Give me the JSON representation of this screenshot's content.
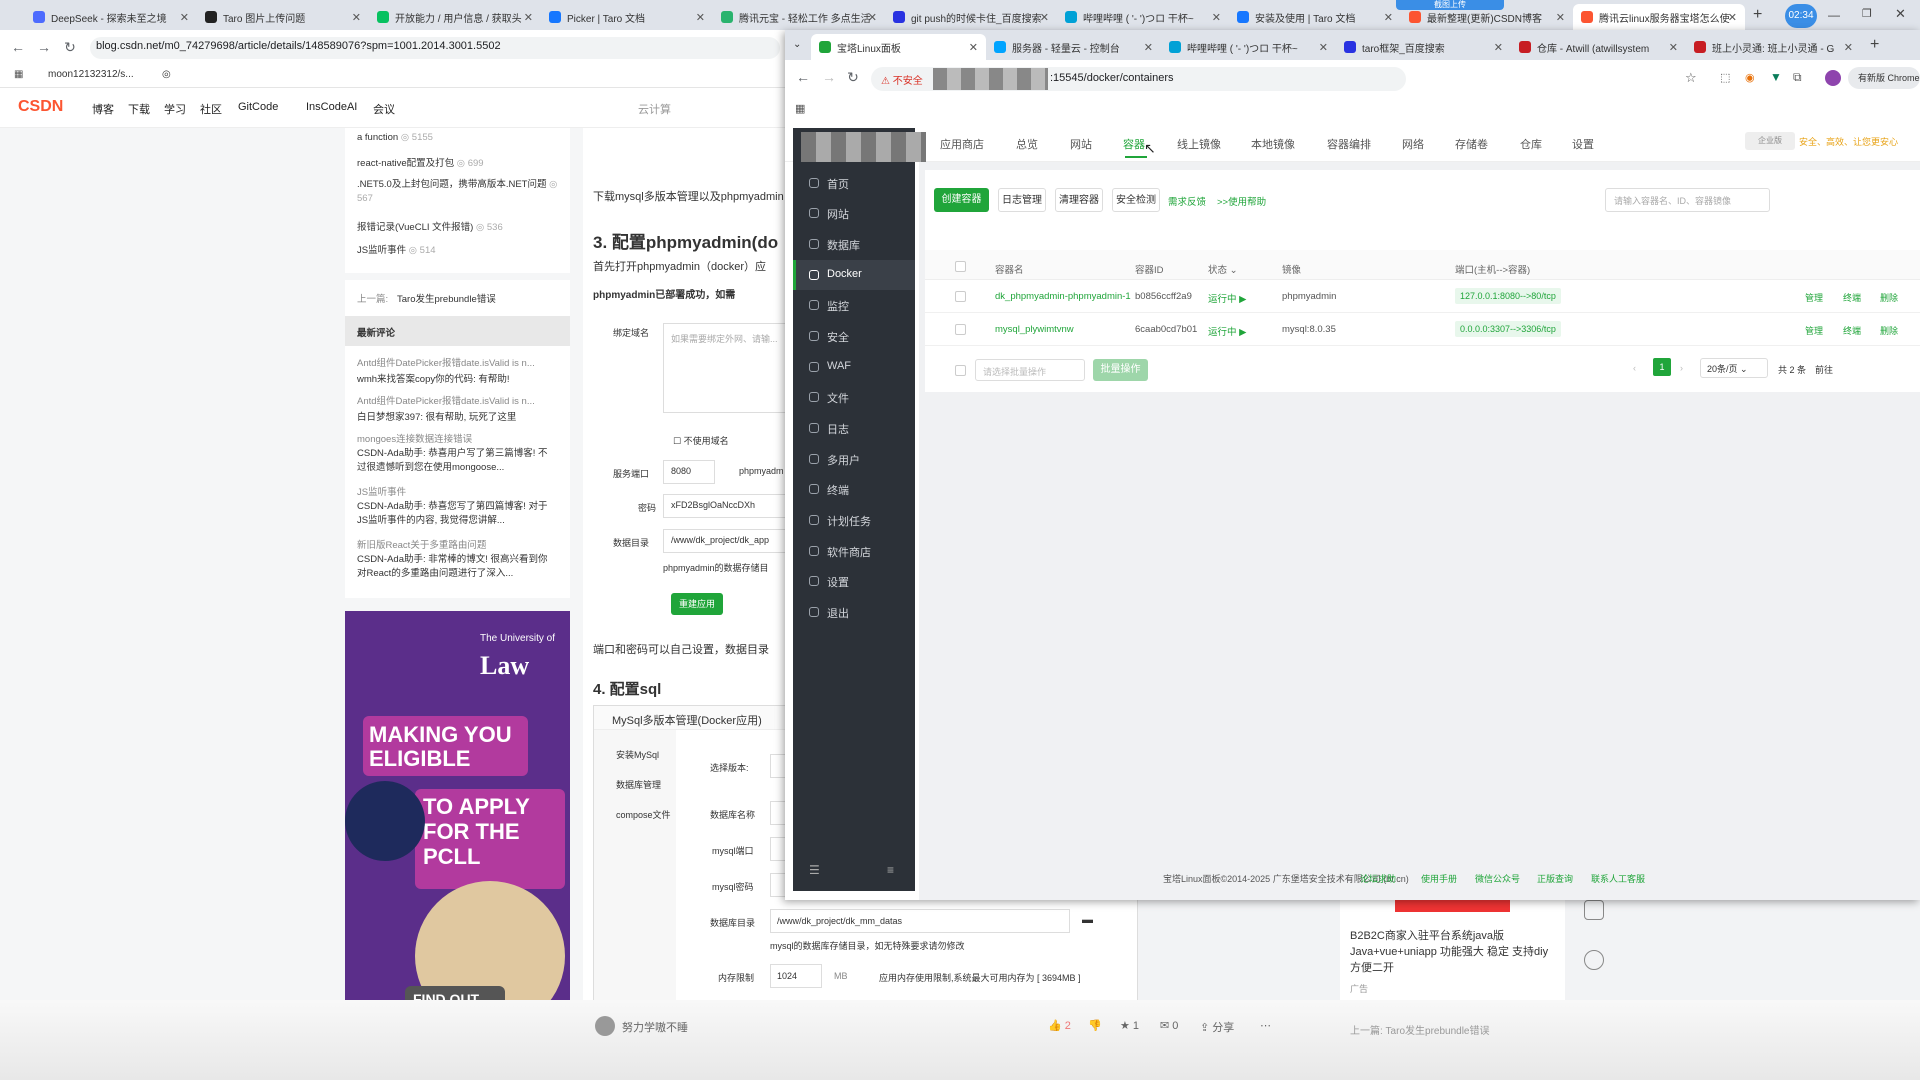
{
  "back_browser": {
    "tabs": [
      "DeepSeek - 探索未至之境",
      "Taro 图片上传问题",
      "开放能力 / 用户信息 / 获取头",
      "Picker | Taro 文档",
      "腾讯元宝 - 轻松工作 多点生活",
      "git push的时候卡住_百度搜索",
      "哔哩哔哩 ( '- ')つロ 干杯~",
      "安装及使用 | Taro 文档",
      "最新整理(更新)CSDN博客",
      "腾讯云linux服务器宝塔怎么使"
    ],
    "url": "blog.csdn.net/m0_74279698/article/details/148589076?spm=1001.2014.3001.5502",
    "bookmark": "moon12132312/s...",
    "csdn_nav": [
      "博客",
      "下载",
      "学习",
      "社区",
      "GitCode",
      "InsCodeAI",
      "会议"
    ],
    "search_hint": "云计算",
    "time_badge": "02:34",
    "upload_badge": "截图上传"
  },
  "csdn_sidebar": {
    "top_items": [
      {
        "title": "a function",
        "count": "5155"
      },
      {
        "title": "react-native配置及打包",
        "count": "699"
      },
      {
        "title": ".NET5.0及上封包问题，携带高版本.NET问题",
        "count": "567"
      },
      {
        "title": "报错记录(VueCLI 文件报错)",
        "count": "536"
      },
      {
        "title": "JS监听事件",
        "count": "514"
      }
    ],
    "prev_link_label": "上一篇:",
    "prev_link": "Taro发生prebundle错误",
    "comments_title": "最新评论",
    "comments": [
      {
        "src": "Antd组件DatePicker报错date.isValid is n...",
        "text": "wmh来找答案copy你的代码: 有帮助!"
      },
      {
        "src": "Antd组件DatePicker报错date.isValid is n...",
        "text": "白日梦想家397: 很有帮助, 玩死了这里"
      },
      {
        "src": "mongoes连接数据连接错误",
        "text": "CSDN-Ada助手: 恭喜用户写了第三篇博客! 不过很遗憾听到您在使用mongoose..."
      },
      {
        "src": "JS监听事件",
        "text": "CSDN-Ada助手: 恭喜您写了第四篇博客! 对于JS监听事件的内容, 我觉得您讲解..."
      },
      {
        "src": "新旧版React关于多重路由问题",
        "text": "CSDN-Ada助手: 非常棒的博文! 很高兴看到你对React的多重路由问题进行了深入..."
      }
    ]
  },
  "ad": {
    "school1": "The University of",
    "school2": "Law",
    "line1": "MAKING YOU ELIGIBLE",
    "line2": "TO APPLY FOR THE PCLL",
    "cta": "FIND OUT MORE"
  },
  "article": {
    "intro": "下载mysql多版本管理以及phpmyadmin",
    "h3": "3. 配置phpmyadmin(do",
    "p1": "首先打开phpmyadmin（docker）应",
    "success": "phpmyadmin已部署成功，如需",
    "fields": {
      "domain_label": "绑定域名",
      "domain_hint": "如果需要绑定外网、请输...",
      "nodomain": "不使用域名",
      "port_label": "服务端口",
      "port_value": "8080",
      "port_suffix": "phpmyadm",
      "pwd_label": "密码",
      "pwd_value": "xFD2BsglOaNccDXh",
      "dir_label": "数据目录",
      "dir_value": "/www/dk_project/dk_app",
      "dir_note": "phpmyadmin的数据存储目",
      "redeploy": "重建应用"
    },
    "p2": "端口和密码可以自己设置，数据目录",
    "h4": "4. 配置sql",
    "mysql_panel": {
      "title": "MySql多版本管理(Docker应用)",
      "menu": [
        "安装MySql",
        "数据库管理",
        "compose文件"
      ],
      "version_label": "选择版本:",
      "dbname_label": "数据库名称",
      "port_label": "mysql端口",
      "pwd_label": "mysql密码",
      "dir_label": "数据库目录",
      "dir_value": "/www/dk_project/dk_mm_datas",
      "dir_note": "mysql的数据库存储目录，如无特殊要求请勿修改",
      "mem_label": "内存限制",
      "mem_value": "1024",
      "mem_unit": "MB",
      "mem_note": "应用内存使用限制,系统最大可用内存为 [ 3694MB ]"
    },
    "author": "努力学嗷不睡",
    "right_card": {
      "title": "B2B2C商家入驻平台系统java版 Java+vue+uniapp 功能强大 稳定 支持diy 方便二开",
      "ad": "广告",
      "prev": "上一篇: Taro发生prebundle错误"
    }
  },
  "front_browser": {
    "tabs": [
      "宝塔Linux面板",
      "服务器 - 轻量云 - 控制台",
      "哔哩哔哩 ( '- ')つロ 干杯~",
      "taro框架_百度搜索",
      "仓库 - Atwill (atwillsystem",
      "班上小灵通: 班上小灵通 - G"
    ],
    "insecure": "不安全",
    "url": ":15545/docker/containers",
    "profile_btn": "有新版 Chrome"
  },
  "bt": {
    "top_nav": [
      "应用商店",
      "总览",
      "网站",
      "容器",
      "线上镜像",
      "本地镜像",
      "容器编排",
      "网络",
      "存储卷",
      "仓库",
      "设置"
    ],
    "active_tab": "容器",
    "badge": "企业版",
    "slogan": "安全、高效、让您更安心",
    "sidebar": [
      "首页",
      "网站",
      "数据库",
      "Docker",
      "监控",
      "安全",
      "WAF",
      "文件",
      "日志",
      "多用户",
      "终端",
      "计划任务",
      "软件商店",
      "设置",
      "退出"
    ],
    "sidebar_active": "Docker",
    "toolbar": {
      "create": "创建容器",
      "logs": "日志管理",
      "clean": "清理容器",
      "security": "安全检测",
      "feedback": "需求反馈",
      "help": ">>使用帮助",
      "search_placeholder": "请输入容器名、ID、容器镜像"
    },
    "columns": [
      "容器名",
      "容器ID",
      "状态",
      "镜像",
      "端口(主机-->容器)"
    ],
    "rows": [
      {
        "name": "dk_phpmyadmin-phpmyadmin-1",
        "id": "b0856ccff2a9",
        "status": "运行中",
        "image": "phpmyadmin",
        "port": "127.0.0.1:8080-->80/tcp",
        "ops": [
          "管理",
          "终端",
          "删除"
        ]
      },
      {
        "name": "mysql_plywimtvnw",
        "id": "6caab0cd7b01",
        "status": "运行中",
        "image": "mysql:8.0.35",
        "port": "0.0.0.0:3307-->3306/tcp",
        "ops": [
          "管理",
          "终端",
          "删除"
        ]
      }
    ],
    "batch_placeholder": "请选择批量操作",
    "batch_btn": "批量操作",
    "page": "1",
    "per_page": "20条/页",
    "total": "共 2 条",
    "goto": "前往",
    "footer_copy": "宝塔Linux面板©2014-2025 广东堡塔安全技术有限公司 (bt.cn)",
    "footer_links": [
      "论坛求助",
      "使用手册",
      "微信公众号",
      "正版查询",
      "联系人工客服"
    ]
  },
  "bottom_bar": {
    "likes": "2",
    "stars": "1",
    "comments": "0",
    "share": "分享"
  }
}
